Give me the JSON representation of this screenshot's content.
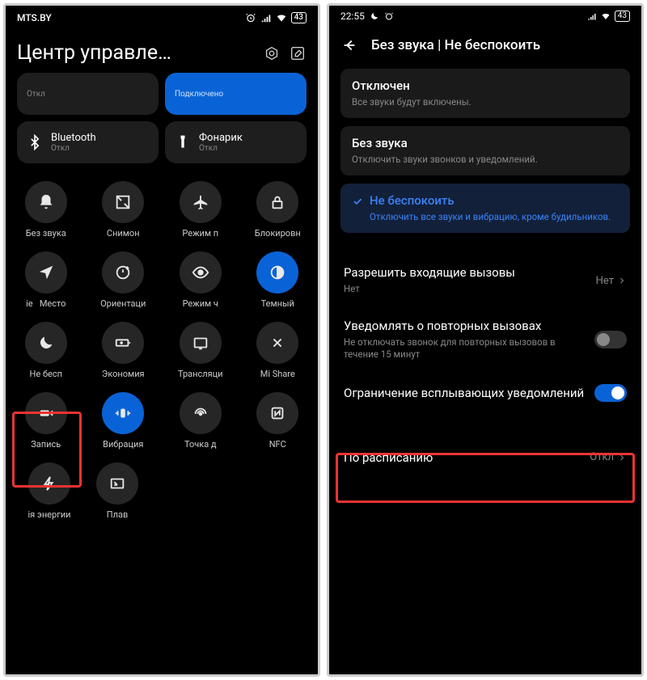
{
  "left": {
    "statusbar": {
      "carrier": "MTS.BY",
      "battery": "43"
    },
    "title": "Центр управле…",
    "tiles": [
      {
        "label": "Откл",
        "sub": ""
      },
      {
        "label": "",
        "sub": "Подключено",
        "connected": true
      },
      {
        "label": "Bluetooth",
        "sub": "Откл"
      },
      {
        "label": "Фонарик",
        "sub": "Откл"
      }
    ],
    "toggles": [
      [
        {
          "label": "Без звука",
          "icon": "bell"
        },
        {
          "label": "Снимон",
          "icon": "screenshot"
        },
        {
          "label": "Режим п",
          "icon": "airplane"
        },
        {
          "label": "Блокировн",
          "icon": "lock"
        }
      ],
      [
        {
          "label": "Место",
          "icon": "location",
          "prefix": "іе"
        },
        {
          "label": "Ориентаци",
          "icon": "rotation"
        },
        {
          "label": "Режим ч",
          "icon": "eye"
        },
        {
          "label": "Темный",
          "icon": "darkmode",
          "active": true
        }
      ],
      [
        {
          "label": "Не бесп",
          "icon": "moon"
        },
        {
          "label": "Экономия",
          "icon": "battery"
        },
        {
          "label": "Трансляци",
          "icon": "cast"
        },
        {
          "label": "Mi Share",
          "icon": "mishare"
        }
      ],
      [
        {
          "label": "Запись",
          "icon": "record"
        },
        {
          "label": "Вибрация",
          "icon": "vibration",
          "active": true
        },
        {
          "label": "Точка д",
          "icon": "hotspot"
        },
        {
          "label": "NFC",
          "icon": "nfc"
        }
      ],
      [
        {
          "label": "ія энергии",
          "icon": "power"
        },
        {
          "label": "Плав",
          "icon": "pip"
        }
      ]
    ]
  },
  "right": {
    "statusbar": {
      "time": "22:55",
      "battery": "43"
    },
    "header": "Без звука | Не беспокоить",
    "options": [
      {
        "title": "Отключен",
        "desc": "Все звуки будут включены."
      },
      {
        "title": "Без звука",
        "desc": "Отключить звуки звонков и уведомлений."
      },
      {
        "title": "Не беспокоить",
        "desc": "Отключить все звуки и вибрацию, кроме будильников.",
        "selected": true
      }
    ],
    "settings": {
      "incoming": {
        "title": "Разрешить входящие вызовы",
        "sub": "Нет",
        "value": "Нет"
      },
      "repeated": {
        "title": "Уведомлять о повторных вызовах",
        "desc": "Не отключать звонок для повторных вызовов в течение 15 минут"
      },
      "popup": {
        "title": "Ограничение всплывающих уведомлений"
      },
      "schedule": {
        "title": "По расписанию",
        "value": "Откл"
      }
    }
  }
}
